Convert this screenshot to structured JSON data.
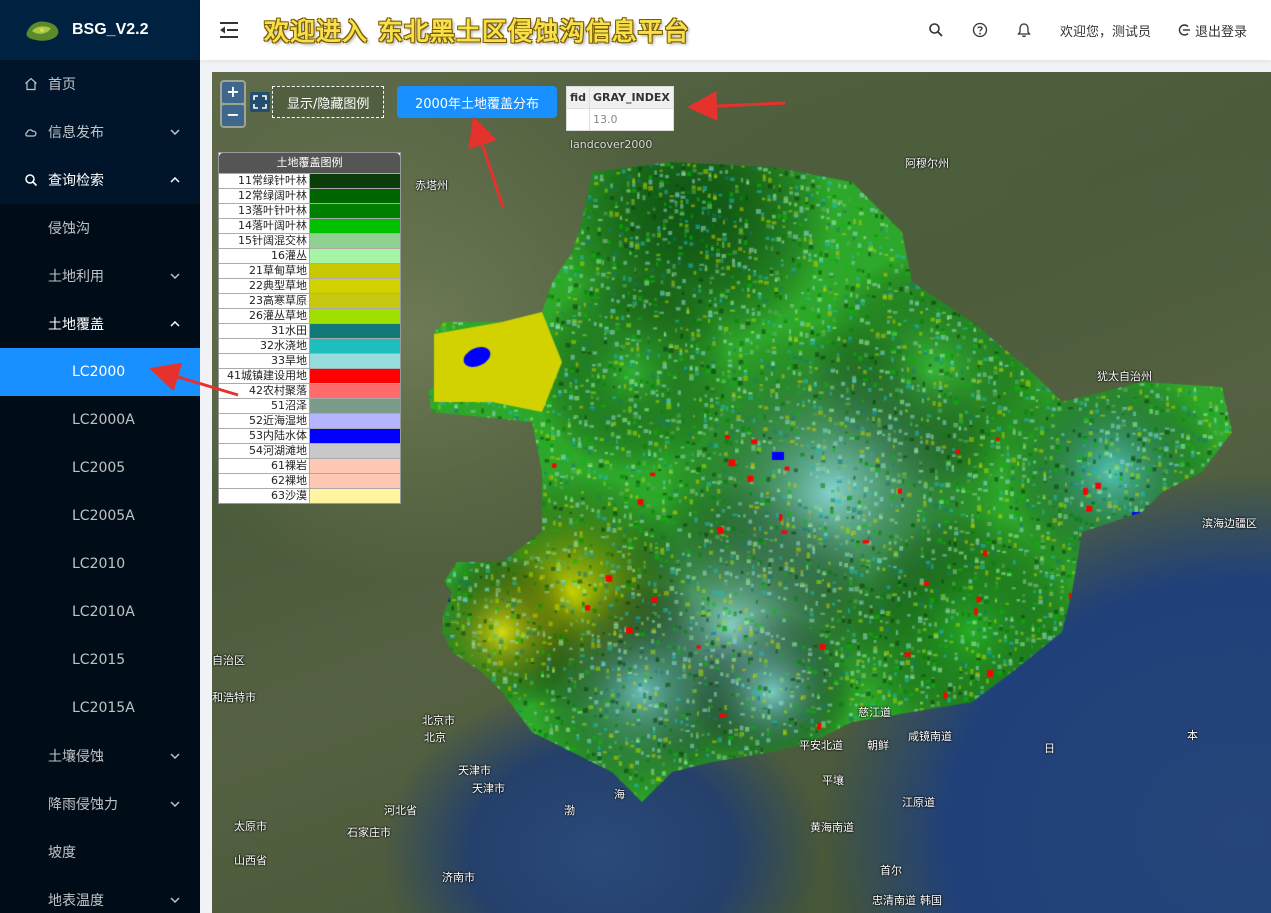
{
  "brand": {
    "name": "BSG_V2.2"
  },
  "header": {
    "title": "欢迎进入 东北黑土区侵蚀沟信息平台",
    "welcome": "欢迎您，测试员",
    "logout": "退出登录"
  },
  "sidebar": {
    "items": [
      {
        "label": "首页",
        "level": 1,
        "icon": "home-icon",
        "arrow": ""
      },
      {
        "label": "信息发布",
        "level": 1,
        "icon": "cloud-icon",
        "arrow": "down"
      },
      {
        "label": "查询检索",
        "level": 1,
        "icon": "search-icon",
        "arrow": "up"
      },
      {
        "label": "侵蚀沟",
        "level": 2,
        "arrow": ""
      },
      {
        "label": "土地利用",
        "level": 2,
        "arrow": "down"
      },
      {
        "label": "土地覆盖",
        "level": 2,
        "arrow": "up"
      },
      {
        "label": "LC2000",
        "level": 3,
        "arrow": "",
        "active": true
      },
      {
        "label": "LC2000A",
        "level": 3,
        "arrow": ""
      },
      {
        "label": "LC2005",
        "level": 3,
        "arrow": ""
      },
      {
        "label": "LC2005A",
        "level": 3,
        "arrow": ""
      },
      {
        "label": "LC2010",
        "level": 3,
        "arrow": ""
      },
      {
        "label": "LC2010A",
        "level": 3,
        "arrow": ""
      },
      {
        "label": "LC2015",
        "level": 3,
        "arrow": ""
      },
      {
        "label": "LC2015A",
        "level": 3,
        "arrow": ""
      },
      {
        "label": "土壤侵蚀",
        "level": 2,
        "arrow": "down"
      },
      {
        "label": "降雨侵蚀力",
        "level": 2,
        "arrow": "down"
      },
      {
        "label": "坡度",
        "level": 2,
        "arrow": ""
      },
      {
        "label": "地表温度",
        "level": 2,
        "arrow": "down"
      }
    ]
  },
  "map": {
    "zoom_in": "+",
    "zoom_out": "−",
    "toggle_legend_label": "显示/隐藏图例",
    "layer_button_label": "2000年土地覆盖分布",
    "feature_table": {
      "headers": [
        "fid",
        "GRAY_INDEX"
      ],
      "row": [
        "",
        "13.0"
      ]
    },
    "layer_name": "landcover2000",
    "legend": {
      "title": "土地覆盖图例",
      "items": [
        {
          "label": "11常绿针叶林",
          "color": "#0a3d0a"
        },
        {
          "label": "12常绿阔叶林",
          "color": "#006400"
        },
        {
          "label": "13落叶针叶林",
          "color": "#007f00"
        },
        {
          "label": "14落叶阔叶林",
          "color": "#00c000"
        },
        {
          "label": "15针阔混交林",
          "color": "#90d090"
        },
        {
          "label": "16灌丛",
          "color": "#a6f5a6"
        },
        {
          "label": "21草甸草地",
          "color": "#c8c800"
        },
        {
          "label": "22典型草地",
          "color": "#d2d200"
        },
        {
          "label": "23高寒草原",
          "color": "#c8c810"
        },
        {
          "label": "26灌丛草地",
          "color": "#a0e000"
        },
        {
          "label": "31水田",
          "color": "#127878"
        },
        {
          "label": "32水浇地",
          "color": "#1ebebe"
        },
        {
          "label": "33旱地",
          "color": "#96dcdc"
        },
        {
          "label": "41城镇建设用地",
          "color": "#ff0000"
        },
        {
          "label": "42农村聚落",
          "color": "#ff6a6a"
        },
        {
          "label": "51沼泽",
          "color": "#7a9a8a"
        },
        {
          "label": "52近海湿地",
          "color": "#b4b4ff"
        },
        {
          "label": "53内陆水体",
          "color": "#0000ff"
        },
        {
          "label": "54河湖滩地",
          "color": "#c8c8c8"
        },
        {
          "label": "61裸岩",
          "color": "#ffc8b4"
        },
        {
          "label": "62裸地",
          "color": "#ffc8b4"
        },
        {
          "label": "63沙漠",
          "color": "#fff5a0"
        }
      ]
    },
    "place_labels": [
      {
        "text": "赤塔州"
      },
      {
        "text": "阿穆尔州"
      },
      {
        "text": "犹太自治州"
      },
      {
        "text": "滨海边疆区"
      },
      {
        "text": "自治区"
      },
      {
        "text": "和浩特市"
      },
      {
        "text": "北京市"
      },
      {
        "text": "北京"
      },
      {
        "text": "天津市"
      },
      {
        "text": "天津市"
      },
      {
        "text": "河北省"
      },
      {
        "text": "太原市"
      },
      {
        "text": "石家庄市"
      },
      {
        "text": "山西省"
      },
      {
        "text": "济南市"
      },
      {
        "text": "慈江道"
      },
      {
        "text": "平安北道"
      },
      {
        "text": "朝鲜"
      },
      {
        "text": "咸镜南道"
      },
      {
        "text": "江原道"
      },
      {
        "text": "黄海南道"
      },
      {
        "text": "首尔"
      },
      {
        "text": "忠清南道"
      },
      {
        "text": "韩国"
      },
      {
        "text": "日"
      },
      {
        "text": "本"
      },
      {
        "text": "渤"
      },
      {
        "text": "海"
      },
      {
        "text": "平壤"
      }
    ]
  }
}
